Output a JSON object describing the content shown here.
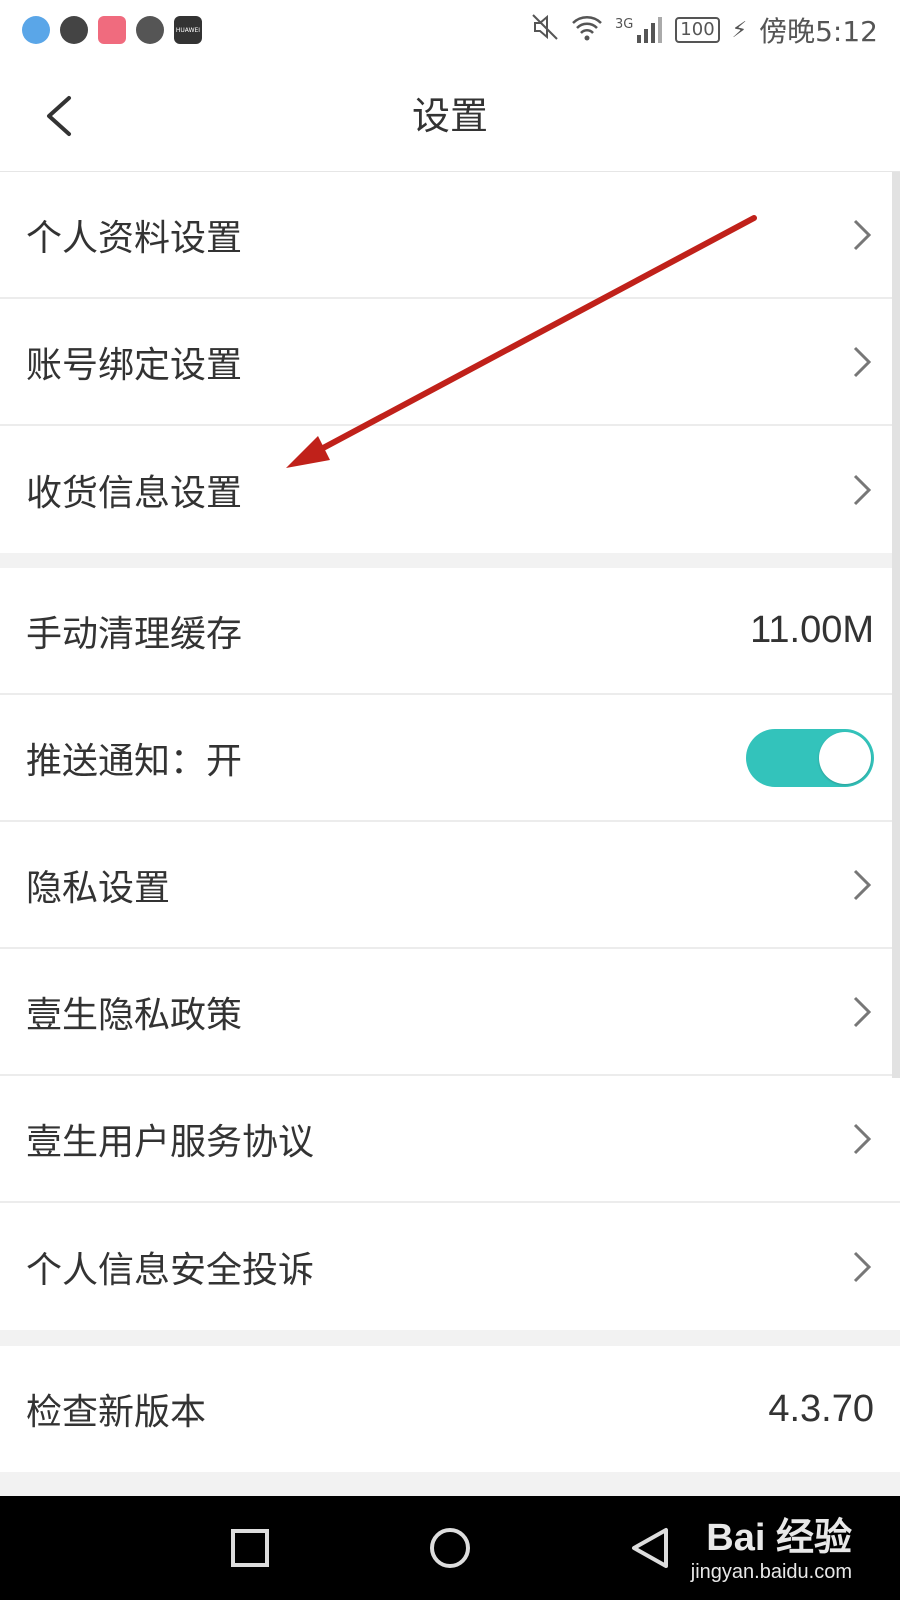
{
  "status_bar": {
    "battery": "100",
    "network": "3G",
    "time": "傍晚5:12",
    "app_icon_label": "HUAWEI"
  },
  "header": {
    "title": "设置"
  },
  "sections": [
    {
      "rows": [
        {
          "label": "个人资料设置",
          "type": "link"
        },
        {
          "label": "账号绑定设置",
          "type": "link"
        },
        {
          "label": "收货信息设置",
          "type": "link"
        }
      ]
    },
    {
      "rows": [
        {
          "label": "手动清理缓存",
          "type": "value",
          "value": "11.00M"
        },
        {
          "label": "推送通知：开",
          "type": "toggle",
          "on": true
        },
        {
          "label": "隐私设置",
          "type": "link"
        },
        {
          "label": "壹生隐私政策",
          "type": "link"
        },
        {
          "label": "壹生用户服务协议",
          "type": "link"
        },
        {
          "label": "个人信息安全投诉",
          "type": "link"
        }
      ]
    },
    {
      "rows": [
        {
          "label": "检查新版本",
          "type": "value",
          "value": "4.3.70"
        }
      ]
    }
  ],
  "watermark": {
    "main": "Bai 经验",
    "sub": "jingyan.baidu.com"
  },
  "colors": {
    "toggle_on": "#33c3bb",
    "arrow": "#c0211a"
  }
}
